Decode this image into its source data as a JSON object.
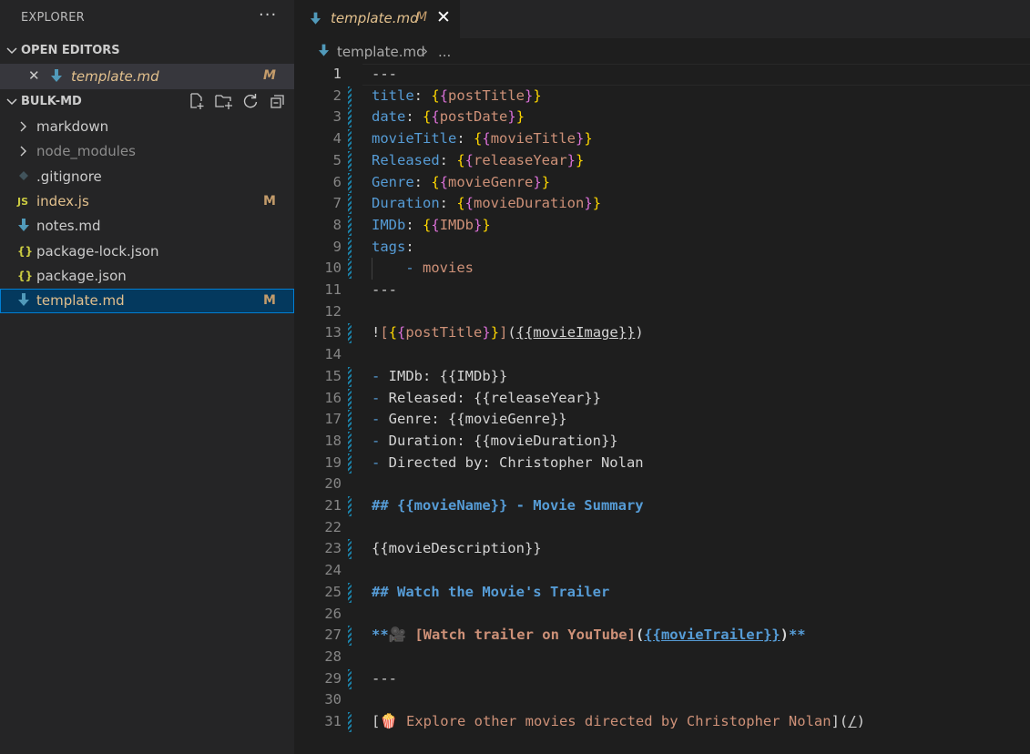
{
  "sidebar": {
    "header": "EXPLORER",
    "more": "···",
    "open_editors": {
      "title": "OPEN EDITORS",
      "items": [
        {
          "close": "✕",
          "name": "template.md",
          "badge": "M"
        }
      ]
    },
    "folder": {
      "title": "BULK-MD",
      "items": [
        {
          "name": "markdown",
          "badge": "",
          "icon": "chevron-right-icon",
          "color": "#cccccc"
        },
        {
          "name": "node_modules",
          "badge": "",
          "icon": "chevron-right-icon",
          "color": "#8c8c8c"
        },
        {
          "name": ".gitignore",
          "badge": "",
          "icon": "git-icon",
          "color": "#cccccc"
        },
        {
          "name": "index.js",
          "badge": "M",
          "icon": "js-icon",
          "icon_text": "JS",
          "color": "#e2c08d"
        },
        {
          "name": "notes.md",
          "badge": "",
          "icon": "markdown-icon",
          "color": "#cccccc"
        },
        {
          "name": "package-lock.json",
          "badge": "",
          "icon": "json-icon",
          "icon_text": "{}",
          "color": "#cccccc"
        },
        {
          "name": "package.json",
          "badge": "",
          "icon": "json-icon",
          "icon_text": "{}",
          "color": "#cccccc"
        },
        {
          "name": "template.md",
          "badge": "M",
          "icon": "markdown-icon",
          "color": "#e2c08d",
          "selected": true
        }
      ]
    }
  },
  "editor": {
    "tab": {
      "name": "template.md",
      "modified": "M",
      "close": "✕"
    },
    "breadcrumb": {
      "file": "template.md",
      "separator": "›",
      "rest": "..."
    },
    "lines": [
      {
        "n": "1",
        "t": "---"
      },
      {
        "n": "2",
        "t": "title: {{postTitle}}"
      },
      {
        "n": "3",
        "t": "date: {{postDate}}"
      },
      {
        "n": "4",
        "t": "movieTitle: {{movieTitle}}"
      },
      {
        "n": "5",
        "t": "Released: {{releaseYear}}"
      },
      {
        "n": "6",
        "t": "Genre: {{movieGenre}}"
      },
      {
        "n": "7",
        "t": "Duration: {{movieDuration}}"
      },
      {
        "n": "8",
        "t": "IMDb: {{IMDb}}"
      },
      {
        "n": "9",
        "t": "tags:"
      },
      {
        "n": "10",
        "t": "    - movies"
      },
      {
        "n": "11",
        "t": "---"
      },
      {
        "n": "12",
        "t": ""
      },
      {
        "n": "13",
        "t": "![{{postTitle}}]({{movieImage}})"
      },
      {
        "n": "14",
        "t": ""
      },
      {
        "n": "15",
        "t": "- IMDb: {{IMDb}}"
      },
      {
        "n": "16",
        "t": "- Released: {{releaseYear}}"
      },
      {
        "n": "17",
        "t": "- Genre: {{movieGenre}}"
      },
      {
        "n": "18",
        "t": "- Duration: {{movieDuration}}"
      },
      {
        "n": "19",
        "t": "- Directed by: Christopher Nolan"
      },
      {
        "n": "20",
        "t": ""
      },
      {
        "n": "21",
        "t": "## {{movieName}} - Movie Summary"
      },
      {
        "n": "22",
        "t": ""
      },
      {
        "n": "23",
        "t": "{{movieDescription}}"
      },
      {
        "n": "24",
        "t": ""
      },
      {
        "n": "25",
        "t": "## Watch the Movie's Trailer"
      },
      {
        "n": "26",
        "t": ""
      },
      {
        "n": "27",
        "t": "**🎥 [Watch trailer on YouTube]({{movieTrailer}})**"
      },
      {
        "n": "28",
        "t": ""
      },
      {
        "n": "29",
        "t": "---"
      },
      {
        "n": "30",
        "t": ""
      },
      {
        "n": "31",
        "t": "[🍿 Explore other movies directed by Christopher Nolan](/)"
      }
    ]
  },
  "colors": {
    "accent": "#007fd4",
    "modified": "#e2c08d",
    "selected_bg": "#04395e"
  }
}
